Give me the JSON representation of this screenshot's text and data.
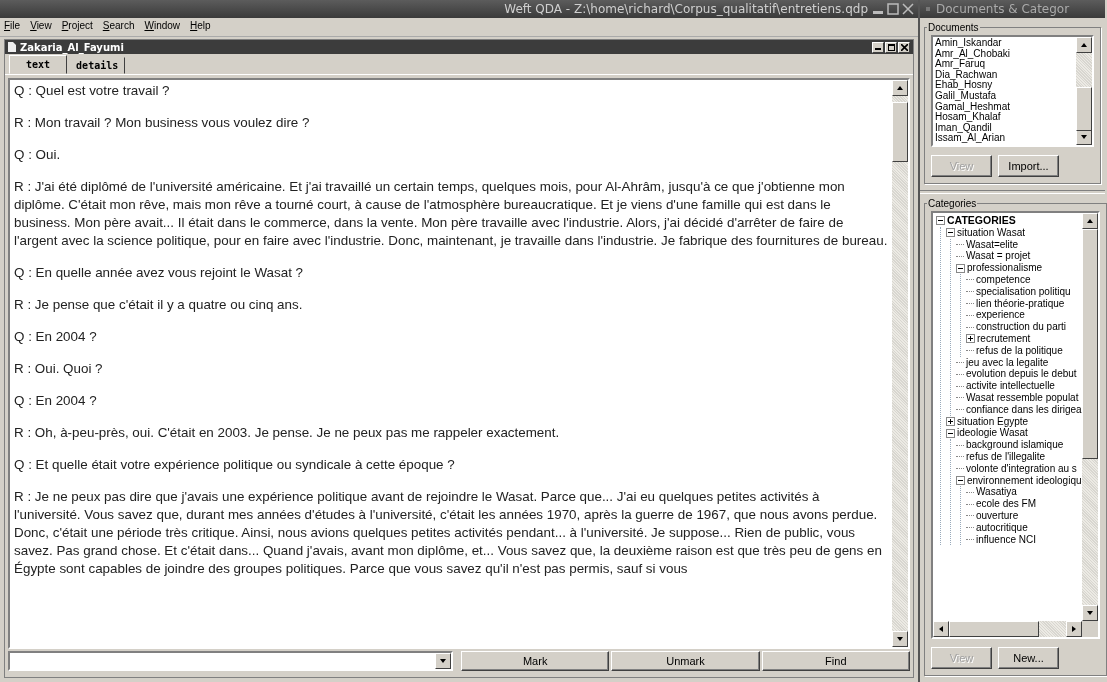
{
  "main_window": {
    "title": "Weft QDA - Z:\\home\\richard\\Corpus_qualitatif\\entretiens.qdp",
    "menu": [
      "File",
      "View",
      "Project",
      "Search",
      "Window",
      "Help"
    ],
    "document_window": {
      "title": "Zakaria_Al_Fayumi",
      "tabs": [
        {
          "label": "text",
          "selected": true
        },
        {
          "label": "details",
          "selected": false
        }
      ],
      "paragraphs": [
        "Q : Quel est votre travail ?",
        "R : Mon travail ? Mon business vous voulez dire ?",
        "Q : Oui.",
        "R : J'ai été diplômé de l'université américaine. Et j'ai travaillé un certain temps, quelques mois, pour Al-Ahrâm, jusqu'à ce que j'obtienne mon diplôme. C'était mon rêve, mais mon rêve a tourné court, à cause de l'atmosphère bureaucratique. Et je viens d'une famille qui est dans le business. Mon père avait... Il était dans le commerce, dans la vente. Mon père travaille avec l'industrie. Alors, j'ai décidé d'arrêter de faire de l'argent avec la science politique, pour en faire avec l'industrie. Donc, maintenant, je travaille dans l'industrie. Je fabrique des fournitures de bureau.",
        "Q : En quelle année avez vous rejoint le Wasat ?",
        "R : Je pense que c'était il y a quatre ou cinq ans.",
        "Q : En 2004 ?",
        "R : Oui. Quoi ?",
        "Q : En 2004 ?",
        "R : Oh, à-peu-près, oui. C'était en 2003. Je pense. Je ne peux pas me rappeler exactement.",
        "Q : Et quelle était votre expérience politique ou syndicale à cette époque ?",
        "R : Je ne peux pas dire que j'avais une expérience politique avant de rejoindre le Wasat. Parce que... J'ai eu quelques petites activités à l'université. Vous savez que, durant mes années d'études à l'université, c'était les années 1970, après la guerre de 1967, que nous avons perdue. Donc, c'était une période très critique. Ainsi, nous avions quelques petites activités pendant... à l'université. Je suppose... Rien de public, vous savez. Pas grand chose. Et c'était dans... Quand j'avais, avant mon diplôme, et... Vous savez que, la deuxième raison est que très peu de gens en Égypte sont capables de joindre des groupes politiques. Parce que vous savez qu'il n'est pas permis, sauf si vous"
      ]
    },
    "search_bar": {
      "buttons": [
        "Mark",
        "Unmark",
        "Find"
      ]
    }
  },
  "side_panel": {
    "title": "Documents & Categor",
    "documents": {
      "label": "Documents",
      "items": [
        "Amin_Iskandar",
        "Amr_Al_Chobaki",
        "Amr_Faruq",
        "Dia_Rachwan",
        "Ehab_Hosny",
        "Galil_Mustafa",
        "Gamal_Heshmat",
        "Hosam_Khalaf",
        "Iman_Qandil",
        "Issam_Al_Arian"
      ],
      "buttons": [
        {
          "label": "View",
          "disabled": true
        },
        {
          "label": "Import...",
          "disabled": false
        }
      ]
    },
    "categories": {
      "label": "Categories",
      "tree": [
        {
          "label": "CATEGORIES",
          "expanded": true,
          "children": [
            {
              "label": "situation Wasat",
              "expanded": true,
              "children": [
                {
                  "label": "Wasat=elite"
                },
                {
                  "label": "Wasat = projet"
                },
                {
                  "label": "professionalisme",
                  "expanded": true,
                  "children": [
                    {
                      "label": "competence"
                    },
                    {
                      "label": "specialisation politiqu"
                    },
                    {
                      "label": "lien théorie-pratique"
                    },
                    {
                      "label": "experience"
                    },
                    {
                      "label": "construction du parti"
                    },
                    {
                      "label": "recrutement",
                      "expanded": false
                    },
                    {
                      "label": "refus de la politique"
                    }
                  ]
                },
                {
                  "label": "jeu avec la legalite"
                },
                {
                  "label": "evolution depuis le debut"
                },
                {
                  "label": "activite intellectuelle"
                },
                {
                  "label": "Wasat ressemble populat"
                },
                {
                  "label": "confiance dans les dirigea"
                }
              ]
            },
            {
              "label": "situation Egypte",
              "expanded": false
            },
            {
              "label": "ideologie Wasat",
              "expanded": true,
              "children": [
                {
                  "label": "background islamique"
                },
                {
                  "label": "refus de l'illegalite"
                },
                {
                  "label": "volonte d'integration au s"
                },
                {
                  "label": "environnement ideologiqu",
                  "expanded": true,
                  "children": [
                    {
                      "label": "Wasatiya"
                    },
                    {
                      "label": "ecole des FM"
                    },
                    {
                      "label": "ouverture"
                    },
                    {
                      "label": "autocritique"
                    },
                    {
                      "label": "influence NCI"
                    }
                  ]
                }
              ]
            }
          ]
        }
      ],
      "buttons": [
        {
          "label": "View",
          "disabled": true
        },
        {
          "label": "New...",
          "disabled": false
        }
      ]
    }
  }
}
